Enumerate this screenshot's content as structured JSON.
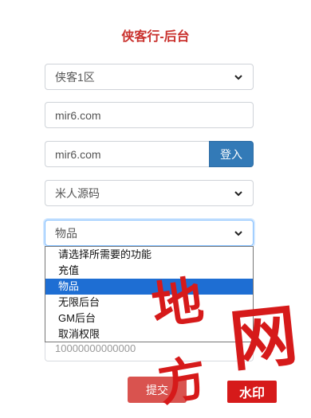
{
  "header": {
    "title": "侠客行-后台"
  },
  "server_select": {
    "value": "侠客1区"
  },
  "host_field": {
    "value": "mir6.com"
  },
  "login_row": {
    "field_value": "mir6.com",
    "button_label": "登入"
  },
  "source_select": {
    "value": "米人源码"
  },
  "function_select": {
    "value": "物品",
    "options": [
      "请选择所需要的功能",
      "充值",
      "物品",
      "无限后台",
      "GM后台",
      "取消权限"
    ]
  },
  "amount_field": {
    "value": "10000000000000"
  },
  "submit": {
    "label": "提交"
  },
  "watermark": {
    "chars": [
      "地",
      "网",
      "方"
    ],
    "badge": "水印"
  },
  "colors": {
    "title": "#c9302c",
    "primary": "#337ab7",
    "danger": "#d9534f",
    "highlight": "#1e6ed3",
    "watermark": "#d61a1a"
  }
}
